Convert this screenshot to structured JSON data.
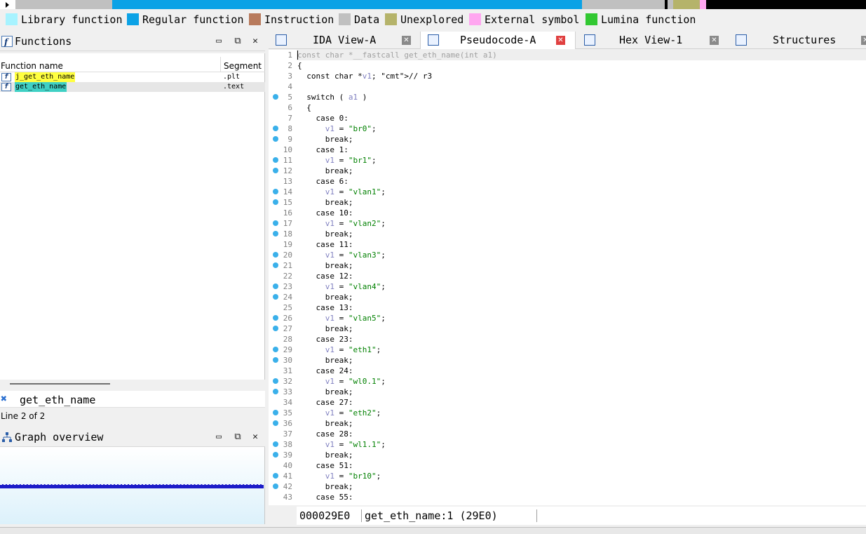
{
  "colors": {
    "library": "#a7f3ff",
    "regular": "#0ba2e6",
    "instruction": "#b87a5c",
    "data": "#c0c0c0",
    "unexplored": "#b5b36a",
    "external": "#ffa6f0",
    "lumina": "#32c832"
  },
  "legend": [
    {
      "label": "Library function",
      "color": "#a7f3ff"
    },
    {
      "label": "Regular function",
      "color": "#0ba2e6"
    },
    {
      "label": "Instruction",
      "color": "#b87a5c"
    },
    {
      "label": "Data",
      "color": "#c0c0c0"
    },
    {
      "label": "Unexplored",
      "color": "#b5b36a"
    },
    {
      "label": "External symbol",
      "color": "#ffa6f0"
    },
    {
      "label": "Lumina function",
      "color": "#32c832"
    }
  ],
  "functions_pane": {
    "title": "Functions",
    "title_icon": "function-icon",
    "col_name": "Function name",
    "col_segment": "Segment",
    "rows": [
      {
        "name": "j_get_eth_name",
        "segment": ".plt",
        "highlight": "#ffff40"
      },
      {
        "name": "get_eth_name",
        "segment": ".text",
        "highlight": "#3fd0c4"
      }
    ]
  },
  "search": {
    "text": "get_eth_name"
  },
  "line_info": "Line 2 of 2",
  "graph_pane": {
    "title": "Graph overview"
  },
  "tabs": [
    {
      "label": "IDA View-A",
      "icon": "disassembly-icon"
    },
    {
      "label": "Pseudocode-A",
      "icon": "pseudocode-icon",
      "active": true
    },
    {
      "label": "Hex View-1",
      "icon": "hex-icon"
    },
    {
      "label": "Structures",
      "icon": "structures-icon"
    }
  ],
  "code": [
    {
      "n": "1",
      "bp": false,
      "text": "const char *__fastcall get_eth_name(int a1)"
    },
    {
      "n": "2",
      "bp": false,
      "text": "{"
    },
    {
      "n": "3",
      "bp": false,
      "text": "  const char *v1; // r3"
    },
    {
      "n": "4",
      "bp": false,
      "text": ""
    },
    {
      "n": "5",
      "bp": true,
      "text": "  switch ( a1 )"
    },
    {
      "n": "6",
      "bp": false,
      "text": "  {"
    },
    {
      "n": "7",
      "bp": false,
      "text": "    case 0:"
    },
    {
      "n": "8",
      "bp": true,
      "text": "      v1 = \"br0\";"
    },
    {
      "n": "9",
      "bp": true,
      "text": "      break;"
    },
    {
      "n": "10",
      "bp": false,
      "text": "    case 1:"
    },
    {
      "n": "11",
      "bp": true,
      "text": "      v1 = \"br1\";"
    },
    {
      "n": "12",
      "bp": true,
      "text": "      break;"
    },
    {
      "n": "13",
      "bp": false,
      "text": "    case 6:"
    },
    {
      "n": "14",
      "bp": true,
      "text": "      v1 = \"vlan1\";"
    },
    {
      "n": "15",
      "bp": true,
      "text": "      break;"
    },
    {
      "n": "16",
      "bp": false,
      "text": "    case 10:"
    },
    {
      "n": "17",
      "bp": true,
      "text": "      v1 = \"vlan2\";"
    },
    {
      "n": "18",
      "bp": true,
      "text": "      break;"
    },
    {
      "n": "19",
      "bp": false,
      "text": "    case 11:"
    },
    {
      "n": "20",
      "bp": true,
      "text": "      v1 = \"vlan3\";"
    },
    {
      "n": "21",
      "bp": true,
      "text": "      break;"
    },
    {
      "n": "22",
      "bp": false,
      "text": "    case 12:"
    },
    {
      "n": "23",
      "bp": true,
      "text": "      v1 = \"vlan4\";"
    },
    {
      "n": "24",
      "bp": true,
      "text": "      break;"
    },
    {
      "n": "25",
      "bp": false,
      "text": "    case 13:"
    },
    {
      "n": "26",
      "bp": true,
      "text": "      v1 = \"vlan5\";"
    },
    {
      "n": "27",
      "bp": true,
      "text": "      break;"
    },
    {
      "n": "28",
      "bp": false,
      "text": "    case 23:"
    },
    {
      "n": "29",
      "bp": true,
      "text": "      v1 = \"eth1\";"
    },
    {
      "n": "30",
      "bp": true,
      "text": "      break;"
    },
    {
      "n": "31",
      "bp": false,
      "text": "    case 24:"
    },
    {
      "n": "32",
      "bp": true,
      "text": "      v1 = \"wl0.1\";"
    },
    {
      "n": "33",
      "bp": true,
      "text": "      break;"
    },
    {
      "n": "34",
      "bp": false,
      "text": "    case 27:"
    },
    {
      "n": "35",
      "bp": true,
      "text": "      v1 = \"eth2\";"
    },
    {
      "n": "36",
      "bp": true,
      "text": "      break;"
    },
    {
      "n": "37",
      "bp": false,
      "text": "    case 28:"
    },
    {
      "n": "38",
      "bp": true,
      "text": "      v1 = \"wl1.1\";"
    },
    {
      "n": "39",
      "bp": true,
      "text": "      break;"
    },
    {
      "n": "40",
      "bp": false,
      "text": "    case 51:"
    },
    {
      "n": "41",
      "bp": true,
      "text": "      v1 = \"br10\";"
    },
    {
      "n": "42",
      "bp": true,
      "text": "      break;"
    },
    {
      "n": "43",
      "bp": false,
      "text": "    case 55:"
    }
  ],
  "status": {
    "address": "000029E0",
    "location": "get_eth_name:1 (29E0)"
  }
}
